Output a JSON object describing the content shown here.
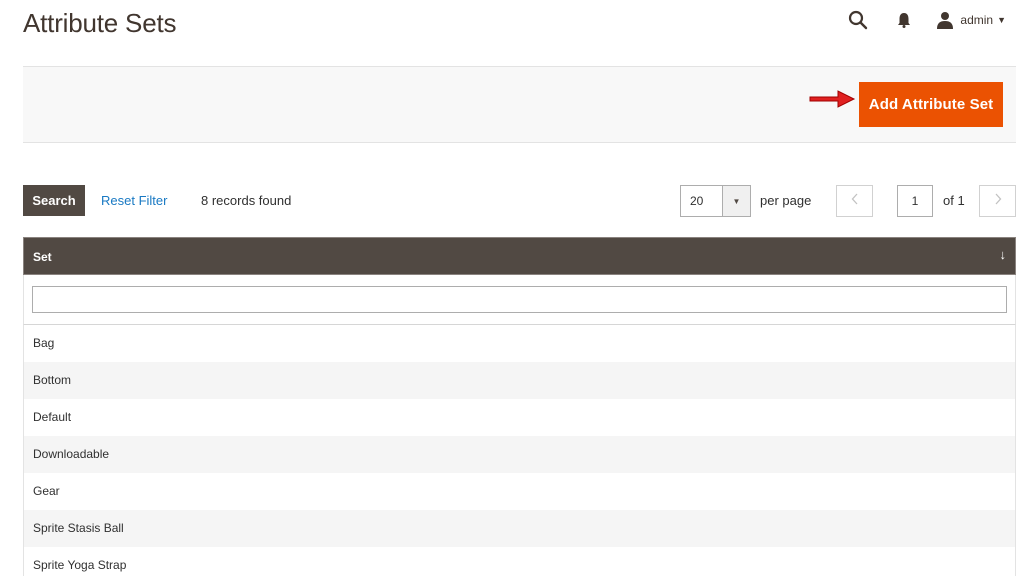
{
  "page": {
    "title": "Attribute Sets"
  },
  "header": {
    "user": "admin",
    "icons": [
      "search-icon",
      "bell-icon",
      "user-icon",
      "caret-down-icon"
    ]
  },
  "actions": {
    "add_label": "Add Attribute Set",
    "accent": "#eb5202"
  },
  "toolbar": {
    "search_label": "Search",
    "reset_label": "Reset Filter",
    "records_found": "8 records found",
    "per_page_value": "20",
    "per_page_label": "per page",
    "current_page": "1",
    "total_pages": "of 1"
  },
  "grid": {
    "column_header": "Set",
    "header_color": "#514943",
    "rows": [
      "Bag",
      "Bottom",
      "Default",
      "Downloadable",
      "Gear",
      "Sprite Stasis Ball",
      "Sprite Yoga Strap"
    ]
  }
}
